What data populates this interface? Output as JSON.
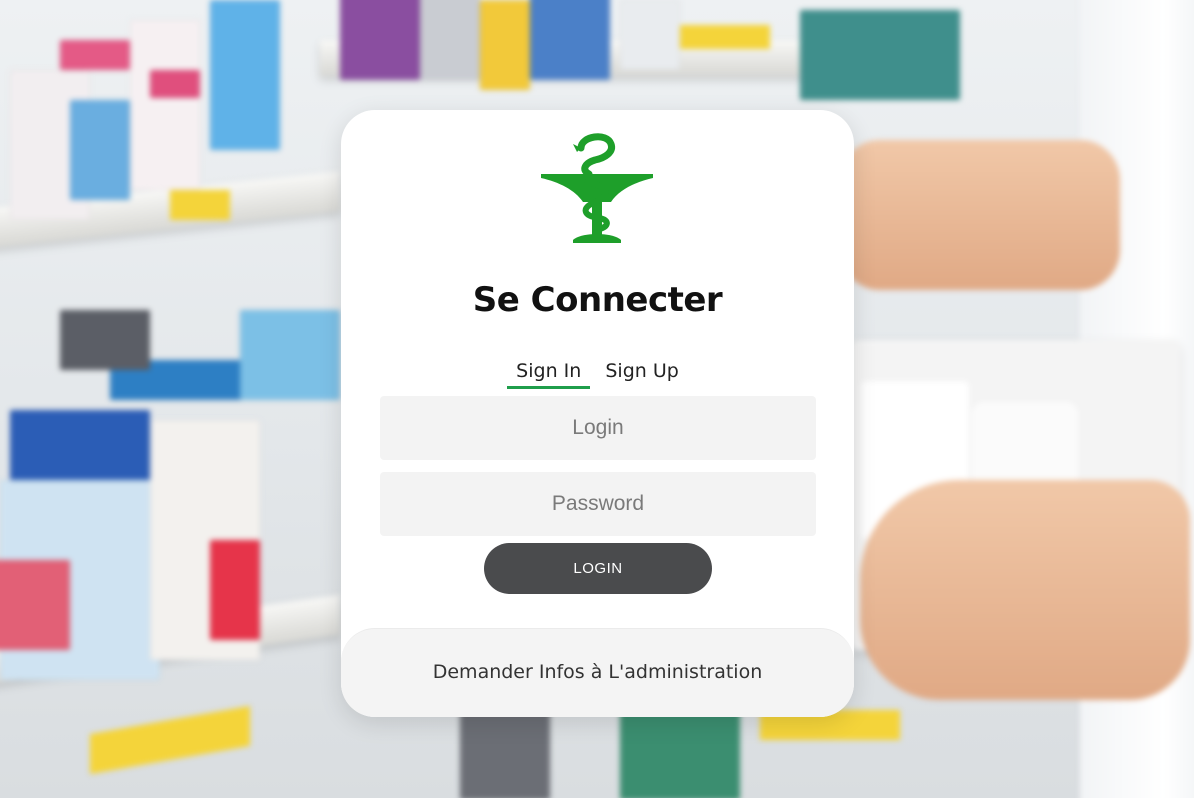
{
  "login_card": {
    "title": "Se Connecter",
    "tabs": [
      {
        "label": "Sign In",
        "active": true
      },
      {
        "label": "Sign Up",
        "active": false
      }
    ],
    "login_field": {
      "placeholder": "Login",
      "value": ""
    },
    "password_field": {
      "placeholder": "Password",
      "value": ""
    },
    "login_button_label": "LOGIN",
    "footer_link": "Demander Infos à L'administration",
    "logo_icon": "pharmacy-caduceus-icon"
  },
  "colors": {
    "accent": "#1f9e4b",
    "logo_green": "#1e9f2a",
    "button": "#4a4b4d",
    "card_background": "#ffffff"
  }
}
